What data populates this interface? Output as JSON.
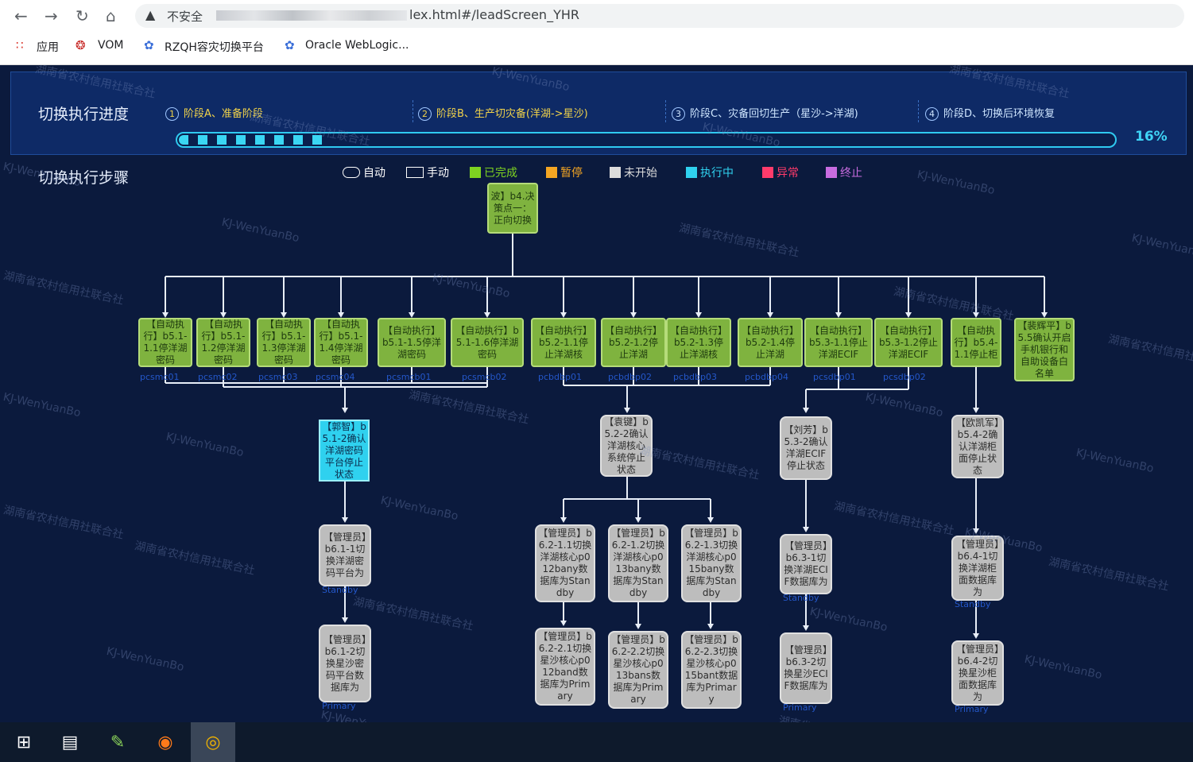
{
  "browser": {
    "security_label": "不安全",
    "url": "lex.html#/leadScreen_YHR",
    "bookmarks": [
      {
        "label": "应用",
        "icon": "apps-grid-icon"
      },
      {
        "label": "VOM",
        "icon": "vom-logo-icon"
      },
      {
        "label": "RZQH容灾切换平台",
        "icon": "weblogic-leaf-icon"
      },
      {
        "label": "Oracle WebLogic...",
        "icon": "weblogic-leaf-icon"
      }
    ]
  },
  "progress_section": {
    "title": "切换执行进度",
    "stages": [
      {
        "num": "1",
        "label": "阶段A、准备阶段",
        "active": true
      },
      {
        "num": "2",
        "label": "阶段B、生产切灾备(洋湖->星沙)",
        "active": true
      },
      {
        "num": "3",
        "label": "阶段C、灾备回切生产（星沙->洋湖)",
        "active": false
      },
      {
        "num": "4",
        "label": "阶段D、切换后环境恢复",
        "active": false
      }
    ],
    "percent_text": "16%",
    "percent_value": 0.16
  },
  "steps_section": {
    "title": "切换执行步骤",
    "legend": [
      {
        "label": "自动",
        "kind": "auto",
        "color": "#ffffff"
      },
      {
        "label": "手动",
        "kind": "manual",
        "color": "#ffffff"
      },
      {
        "label": "已完成",
        "kind": "fill",
        "color": "#7ed321"
      },
      {
        "label": "暂停",
        "kind": "fill",
        "color": "#f5a623"
      },
      {
        "label": "未开始",
        "kind": "fill",
        "color": "#dcdcdc"
      },
      {
        "label": "执行中",
        "kind": "fill",
        "color": "#2fd1ef"
      },
      {
        "label": "异常",
        "kind": "fill",
        "color": "#ff3b6b"
      },
      {
        "label": "终止",
        "kind": "fill",
        "color": "#c86ce0"
      }
    ]
  },
  "nodes": {
    "root": "波】b4.决策点一：正向切换",
    "r1": [
      "【自动执行】b5.1-1.1停洋湖密码",
      "【自动执行】b5.1-1.2停洋湖密码",
      "【自动执行】b5.1-1.3停洋湖密码",
      "【自动执行】b5.1-1.4停洋湖密码",
      "【自动执行】b5.1-1.5停洋湖密码",
      "【自动执行】b5.1-1.6停洋湖密码",
      "【自动执行】b5.2-1.1停止洋湖核",
      "【自动执行】b5.2-1.2停止洋湖",
      "【自动执行】b5.2-1.3停止洋湖核",
      "【自动执行】b5.2-1.4停止洋湖",
      "【自动执行】b5.3-1.1停止洋湖ECIF",
      "【自动执行】b5.3-1.2停止洋湖ECIF",
      "【自动执行】b5.4-1.1停止柜",
      "【裴辉平】b5.5确认开启手机银行和自助设备白名单"
    ],
    "r1_sub": [
      "pcsmc01",
      "pcsmc02",
      "pcsmc03",
      "pcsmc04",
      "pcsmcb01",
      "pcsmcb02",
      "pcbdbp01",
      "pcbdbp02",
      "pcbdbp03",
      "pcbdbp04",
      "pcsdbp01",
      "pcsdbp02",
      "",
      ""
    ],
    "r2": [
      "【郭智】b5.1-2确认洋湖密码平台停止状态",
      "【袁键】b5.2-2确认洋湖核心系统停止状态",
      "【刘芳】b5.3-2确认洋湖ECIF停止状态",
      "【欧凯军】b5.4-2确认洋湖柜面停止状态"
    ],
    "r3": [
      "【管理员】b6.1-1切换洋湖密码平台为",
      "【管理员】b6.2-1.1切换洋湖核心p012bany数据库为Standby",
      "【管理员】b6.2-1.2切换洋湖核心p013bany数据库为Standby",
      "【管理员】b6.2-1.3切换洋湖核心p015bany数据库为Standby",
      "【管理员】b6.3-1切换洋湖ECIF数据库为",
      "【管理员】b6.4-1切换洋湖柜面数据库为"
    ],
    "r3_sub": [
      "Standby",
      "",
      "",
      "",
      "Standby",
      "Standby"
    ],
    "r4": [
      "【管理员】b6.1-2切换星沙密码平台数据库为",
      "【管理员】b6.2-2.1切换星沙核心p012band数据库为Primary",
      "【管理员】b6.2-2.2切换星沙核心p013bans数据库为Primary",
      "【管理员】b6.2-2.3切换星沙核心p015bant数据库为Primary",
      "【管理员】b6.3-2切换星沙ECIF数据库为",
      "【管理员】b6.4-2切换星沙柜面数据库为"
    ],
    "r4_sub": [
      "Primary",
      "",
      "",
      "",
      "Primary",
      "Primary"
    ]
  },
  "watermarks": [
    "湖南省农村信用社联合社",
    "KJ-WenYuanBo"
  ],
  "taskbar": [
    {
      "icon": "windows-start-icon"
    },
    {
      "icon": "task-view-icon"
    },
    {
      "icon": "notepad-chart-icon"
    },
    {
      "icon": "firefox-icon"
    },
    {
      "icon": "chrome-icon"
    }
  ]
}
